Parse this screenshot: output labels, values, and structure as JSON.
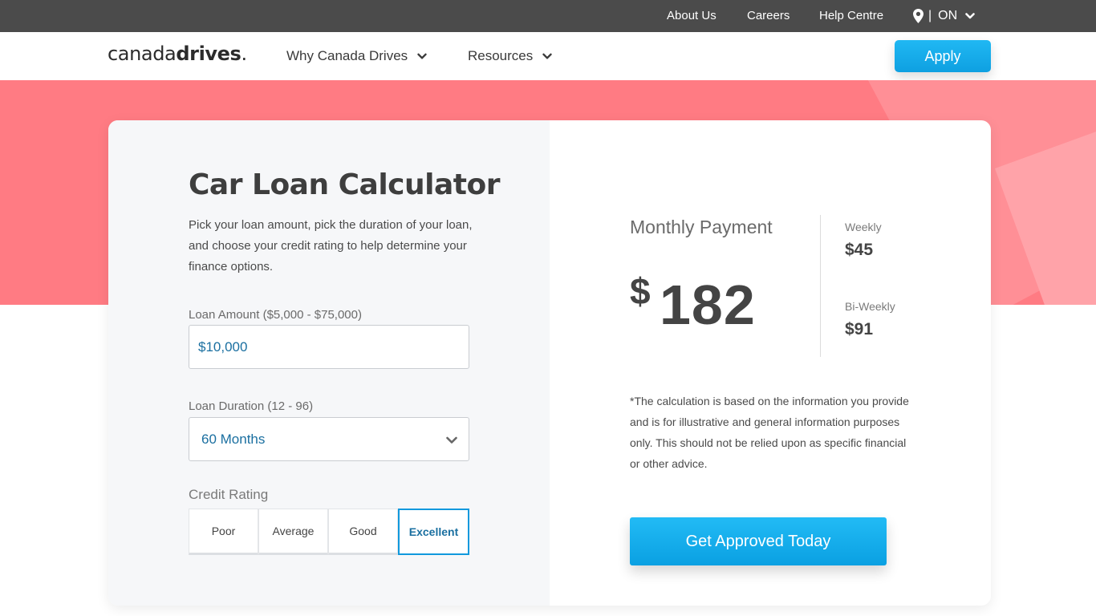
{
  "topbar": {
    "links": [
      "About Us",
      "Careers",
      "Help Centre"
    ],
    "province_separator": "|",
    "province": "ON"
  },
  "nav": {
    "logo_regular": "canada",
    "logo_bold": "drives",
    "logo_mark": ".",
    "items": [
      "Why Canada Drives",
      "Resources"
    ],
    "apply_label": "Apply"
  },
  "calculator": {
    "title": "Car Loan Calculator",
    "description": "Pick your loan amount, pick the duration of your loan, and choose your credit rating to help determine your finance options.",
    "loan_amount_label": "Loan Amount ($5,000 - $75,000)",
    "loan_amount_value": "$10,000",
    "loan_duration_label": "Loan Duration (12 - 96)",
    "loan_duration_value": "60 Months",
    "credit_rating_label": "Credit Rating",
    "credit_options": [
      "Poor",
      "Average",
      "Good",
      "Excellent"
    ],
    "credit_selected": "Excellent"
  },
  "results": {
    "monthly_label": "Monthly Payment",
    "currency_symbol": "$",
    "monthly_value": "182",
    "weekly_label": "Weekly",
    "weekly_value": "$45",
    "biweekly_label": "Bi-Weekly",
    "biweekly_value": "$91",
    "disclaimer": "*The calculation is based on the information you provide and is for illustrative and general information purposes only. This should not be relied upon as specific financial or other advice.",
    "cta_label": "Get Approved Today"
  },
  "colors": {
    "topbar": "#4b4b4b",
    "hero": "#ff7b83",
    "accent": "#14aaeb",
    "value_text": "#1a6fa0"
  },
  "icons": {
    "location": "location-pin-icon",
    "chevron": "chevron-down-icon"
  }
}
